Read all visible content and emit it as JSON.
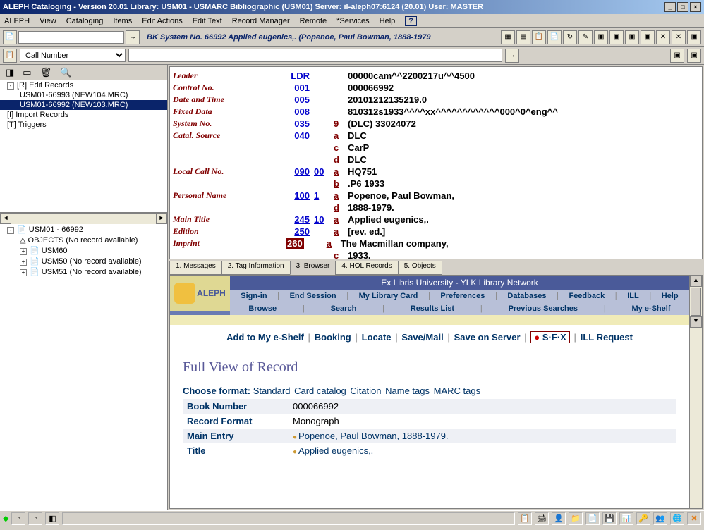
{
  "title": "ALEPH Cataloging - Version 20.01  Library:  USM01 - USMARC Bibliographic (USM01)  Server:  il-aleph07:6124 (20.01)  User:  MASTER",
  "menu": [
    "ALEPH",
    "View",
    "Cataloging",
    "Items",
    "Edit Actions",
    "Edit Text",
    "Record Manager",
    "Remote",
    "*Services",
    "Help"
  ],
  "record_title": "  BK System No. 66992 Applied eugenics,. (Popenoe, Paul Bowman, 1888-1979",
  "callnum": "Call Number",
  "tree": {
    "root": "[R] Edit Records",
    "children": [
      "USM01-66993 (NEW104.MRC)",
      "USM01-66992 (NEW103.MRC)"
    ],
    "import": "[I] Import Records",
    "triggers": "[T] Triggers"
  },
  "tree2": {
    "root": "USM01 - 66992",
    "objects": "OBJECTS (No record available)",
    "usm60": "USM60",
    "usm50": "USM50 (No record available)",
    "usm51": "USM51 (No record available)"
  },
  "marc": [
    {
      "label": "Leader",
      "tag": "LDR",
      "ind": "",
      "sub": "",
      "val": "00000cam^^2200217u^^4500"
    },
    {
      "label": "Control No.",
      "tag": "001",
      "ind": "",
      "sub": "",
      "val": "000066992"
    },
    {
      "label": "Date and Time",
      "tag": "005",
      "ind": "",
      "sub": "",
      "val": "20101212135219.0"
    },
    {
      "label": "Fixed Data",
      "tag": "008",
      "ind": "",
      "sub": "",
      "val": "810312s1933^^^^xx^^^^^^^^^^^^000^0^eng^^"
    },
    {
      "label": "System No.",
      "tag": "035",
      "ind": "",
      "sub": "9",
      "val": "(DLC) 33024072"
    },
    {
      "label": "Catal. Source",
      "tag": "040",
      "ind": "",
      "sub": "a",
      "val": "DLC"
    },
    {
      "label": "",
      "tag": "",
      "ind": "",
      "sub": "c",
      "val": "CarP"
    },
    {
      "label": "",
      "tag": "",
      "ind": "",
      "sub": "d",
      "val": "DLC"
    },
    {
      "label": "Local Call No.",
      "tag": "090",
      "ind": "00",
      "sub": "a",
      "val": "HQ751"
    },
    {
      "label": "",
      "tag": "",
      "ind": "",
      "sub": "b",
      "val": ".P6 1933"
    },
    {
      "label": "Personal Name",
      "tag": "100",
      "ind": "1",
      "sub": "a",
      "val": "Popenoe, Paul Bowman,"
    },
    {
      "label": "",
      "tag": "",
      "ind": "",
      "sub": "d",
      "val": "1888-1979."
    },
    {
      "label": "Main Title",
      "tag": "245",
      "ind": "10",
      "sub": "a",
      "val": "Applied eugenics,."
    },
    {
      "label": "Edition",
      "tag": "250",
      "ind": "",
      "sub": "a",
      "val": "[rev. ed.]"
    },
    {
      "label": "Imprint",
      "tag": "260",
      "ind": "",
      "sub": "a",
      "val": "The Macmillan company,",
      "sel": true
    },
    {
      "label": "",
      "tag": "",
      "ind": "",
      "sub": "c",
      "val": "1933."
    }
  ],
  "bottom_tabs": [
    "1. Messages",
    "2. Tag Information",
    "3. Browser",
    "4. HOL Records",
    "5. Objects"
  ],
  "opac": {
    "title": "Ex Libris University - YLK Library Network",
    "logo": "ALEPH",
    "nav1": [
      "Sign-in",
      "End Session",
      "My Library Card",
      "Preferences",
      "Databases",
      "Feedback",
      "ILL",
      "Help"
    ],
    "nav2": [
      "Browse",
      "Search",
      "Results List",
      "Previous Searches",
      "My e-Shelf"
    ],
    "actions_pre": [
      "Add to My e-Shelf",
      "Booking",
      "Locate",
      "Save/Mail",
      "Save on Server"
    ],
    "sfx": "S·F·X",
    "ill": "ILL Request",
    "h1": "Full View of Record",
    "choose": "Choose format:",
    "formats": [
      "Standard",
      "Card catalog",
      "Citation",
      "Name tags",
      "MARC tags"
    ],
    "rows": [
      {
        "k": "Book Number",
        "v": "000066992",
        "link": false
      },
      {
        "k": "Record Format",
        "v": "Monograph",
        "link": false
      },
      {
        "k": "Main Entry",
        "v": "Popenoe, Paul Bowman, 1888-1979.",
        "link": true
      },
      {
        "k": "Title",
        "v": "Applied eugenics,.",
        "link": true
      }
    ]
  }
}
